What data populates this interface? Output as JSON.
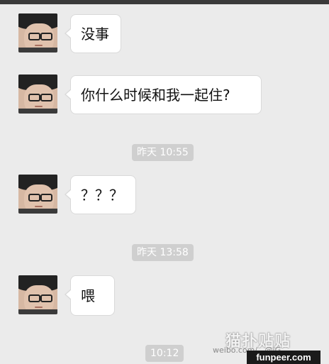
{
  "messages": [
    {
      "text": "没事"
    },
    {
      "text": "你什么时候和我一起住?"
    },
    {
      "text": "？？？"
    },
    {
      "text": "喂"
    }
  ],
  "timestamps": [
    "昨天 10:55",
    "昨天 13:58",
    "10:12"
  ],
  "watermark": {
    "logo_text": "猫扑贴贴",
    "site": "funpeer.com",
    "weibo": "weibo.com/...@iG..."
  }
}
